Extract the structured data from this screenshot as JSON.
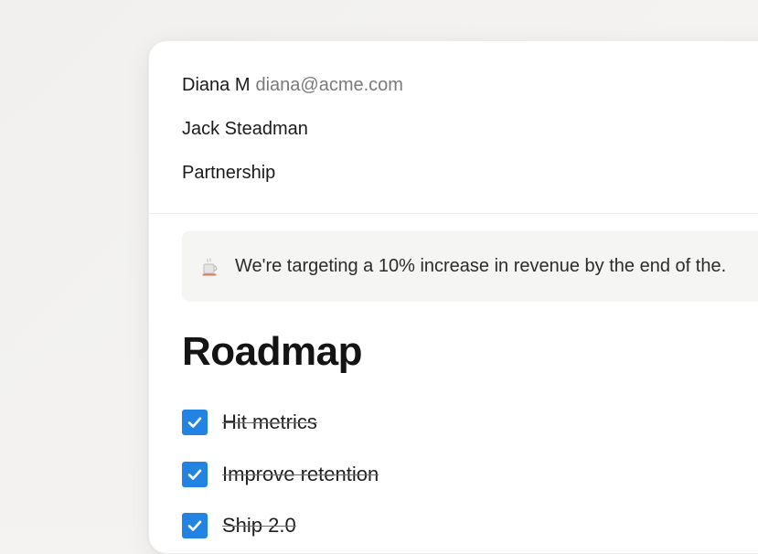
{
  "meta": {
    "from_name": "Diana M",
    "from_email": "diana@acme.com",
    "to_name": "Jack Steadman",
    "subject": "Partnership"
  },
  "callout": {
    "icon": "coffee-icon",
    "text": "We're targeting a 10% increase in revenue by the end of the."
  },
  "content": {
    "heading": "Roadmap",
    "todos": [
      {
        "label": "Hit metrics",
        "checked": true
      },
      {
        "label": "Improve retention",
        "checked": true
      },
      {
        "label": "Ship 2.0",
        "checked": true
      }
    ]
  },
  "colors": {
    "accent": "#2383e2",
    "background": "#f4f3f1",
    "card": "#ffffff",
    "callout_bg": "#f5f5f4"
  }
}
